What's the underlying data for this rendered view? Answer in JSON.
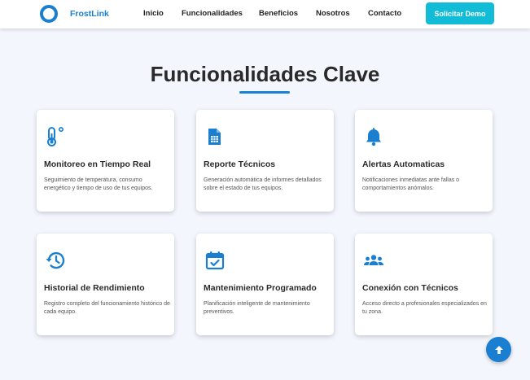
{
  "brand": {
    "name": "FrostLink",
    "color": "#1a7fd0"
  },
  "nav": {
    "links": [
      "Inicio",
      "Funcionalidades",
      "Beneficios",
      "Nosotros",
      "Contacto"
    ],
    "cta_label": "Solicitar Demo",
    "cta_color": "#12bcd6"
  },
  "section": {
    "title": "Funcionalidades Clave",
    "accent_color": "#1a7fd0"
  },
  "features": [
    {
      "icon": "thermometer-icon",
      "title": "Monitoreo en Tiempo Real",
      "description": "Seguimiento de temperatura, consumo energético y tiempo de uso de tus equipos."
    },
    {
      "icon": "document-report-icon",
      "title": "Reporte Técnicos",
      "description": "Generación automática de informes detallados sobre el estado de tus equipos."
    },
    {
      "icon": "bell-icon",
      "title": "Alertas Automaticas",
      "description": "Notificaciones inmediatas ante fallas o comportamientos anómalos."
    },
    {
      "icon": "history-icon",
      "title": "Historial de Rendimiento",
      "description": "Registro completo del funcionamiento histórico de cada equipo."
    },
    {
      "icon": "calendar-check-icon",
      "title": "Mantenimiento Programado",
      "description": "Planificación inteligente de mantenimiento preventivos."
    },
    {
      "icon": "people-group-icon",
      "title": "Conexión con Técnicos",
      "description": "Acceso directo a profesionales especializados en tu zona."
    }
  ],
  "scroll_top": {
    "icon": "arrow-up-icon"
  }
}
